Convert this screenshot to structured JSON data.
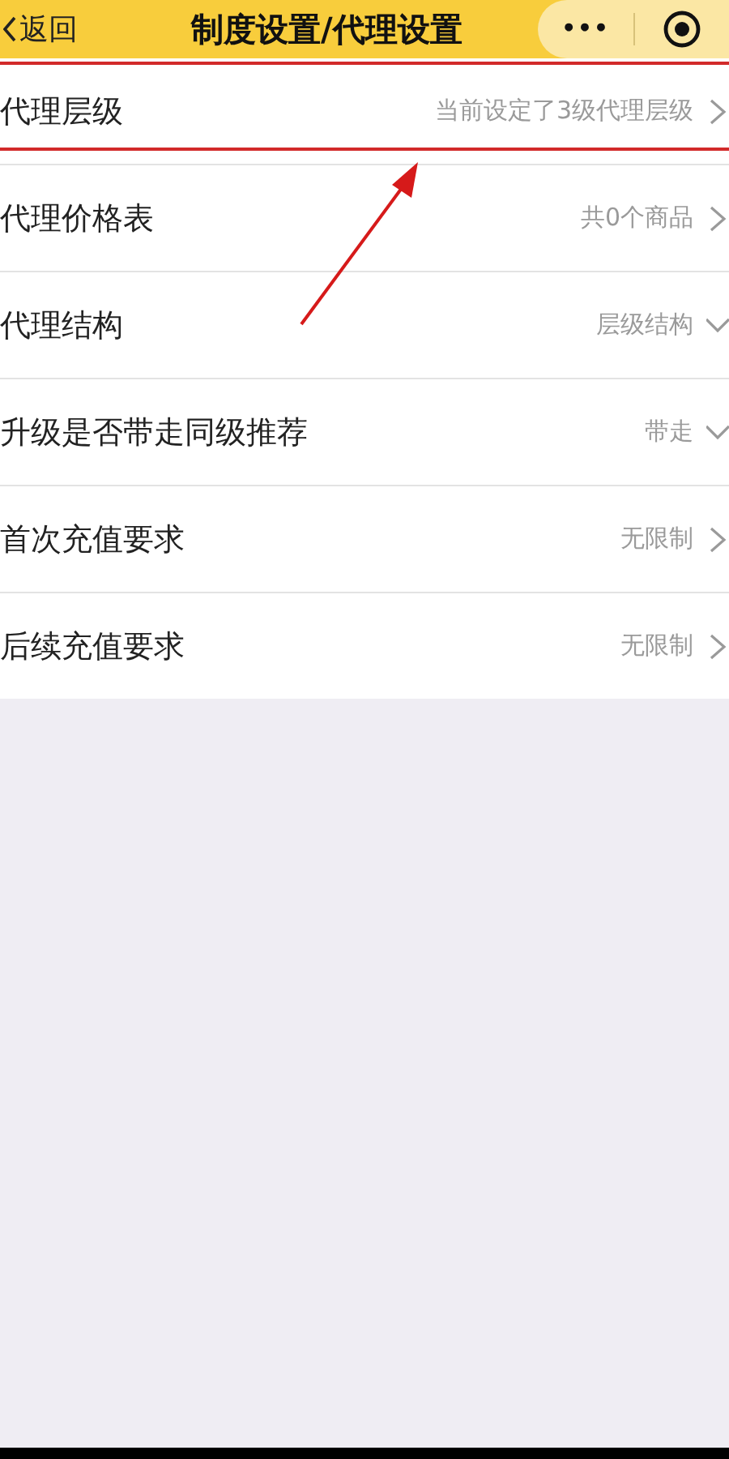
{
  "header": {
    "back_label": "返回",
    "title": "制度设置/代理设置",
    "menu_glyph": "•••"
  },
  "settings": [
    {
      "label": "代理层级",
      "value": "当前设定了3级代理层级",
      "kind": "link",
      "highlighted": true
    },
    {
      "label": "代理价格表",
      "value": "共0个商品",
      "kind": "link",
      "highlighted": false
    },
    {
      "label": "代理结构",
      "value": "层级结构",
      "kind": "dropdown",
      "highlighted": false
    },
    {
      "label": "升级是否带走同级推荐",
      "value": "带走",
      "kind": "dropdown",
      "highlighted": false
    },
    {
      "label": "首次充值要求",
      "value": "无限制",
      "kind": "link",
      "highlighted": false
    },
    {
      "label": "后续充值要求",
      "value": "无限制",
      "kind": "link",
      "highlighted": false
    }
  ]
}
